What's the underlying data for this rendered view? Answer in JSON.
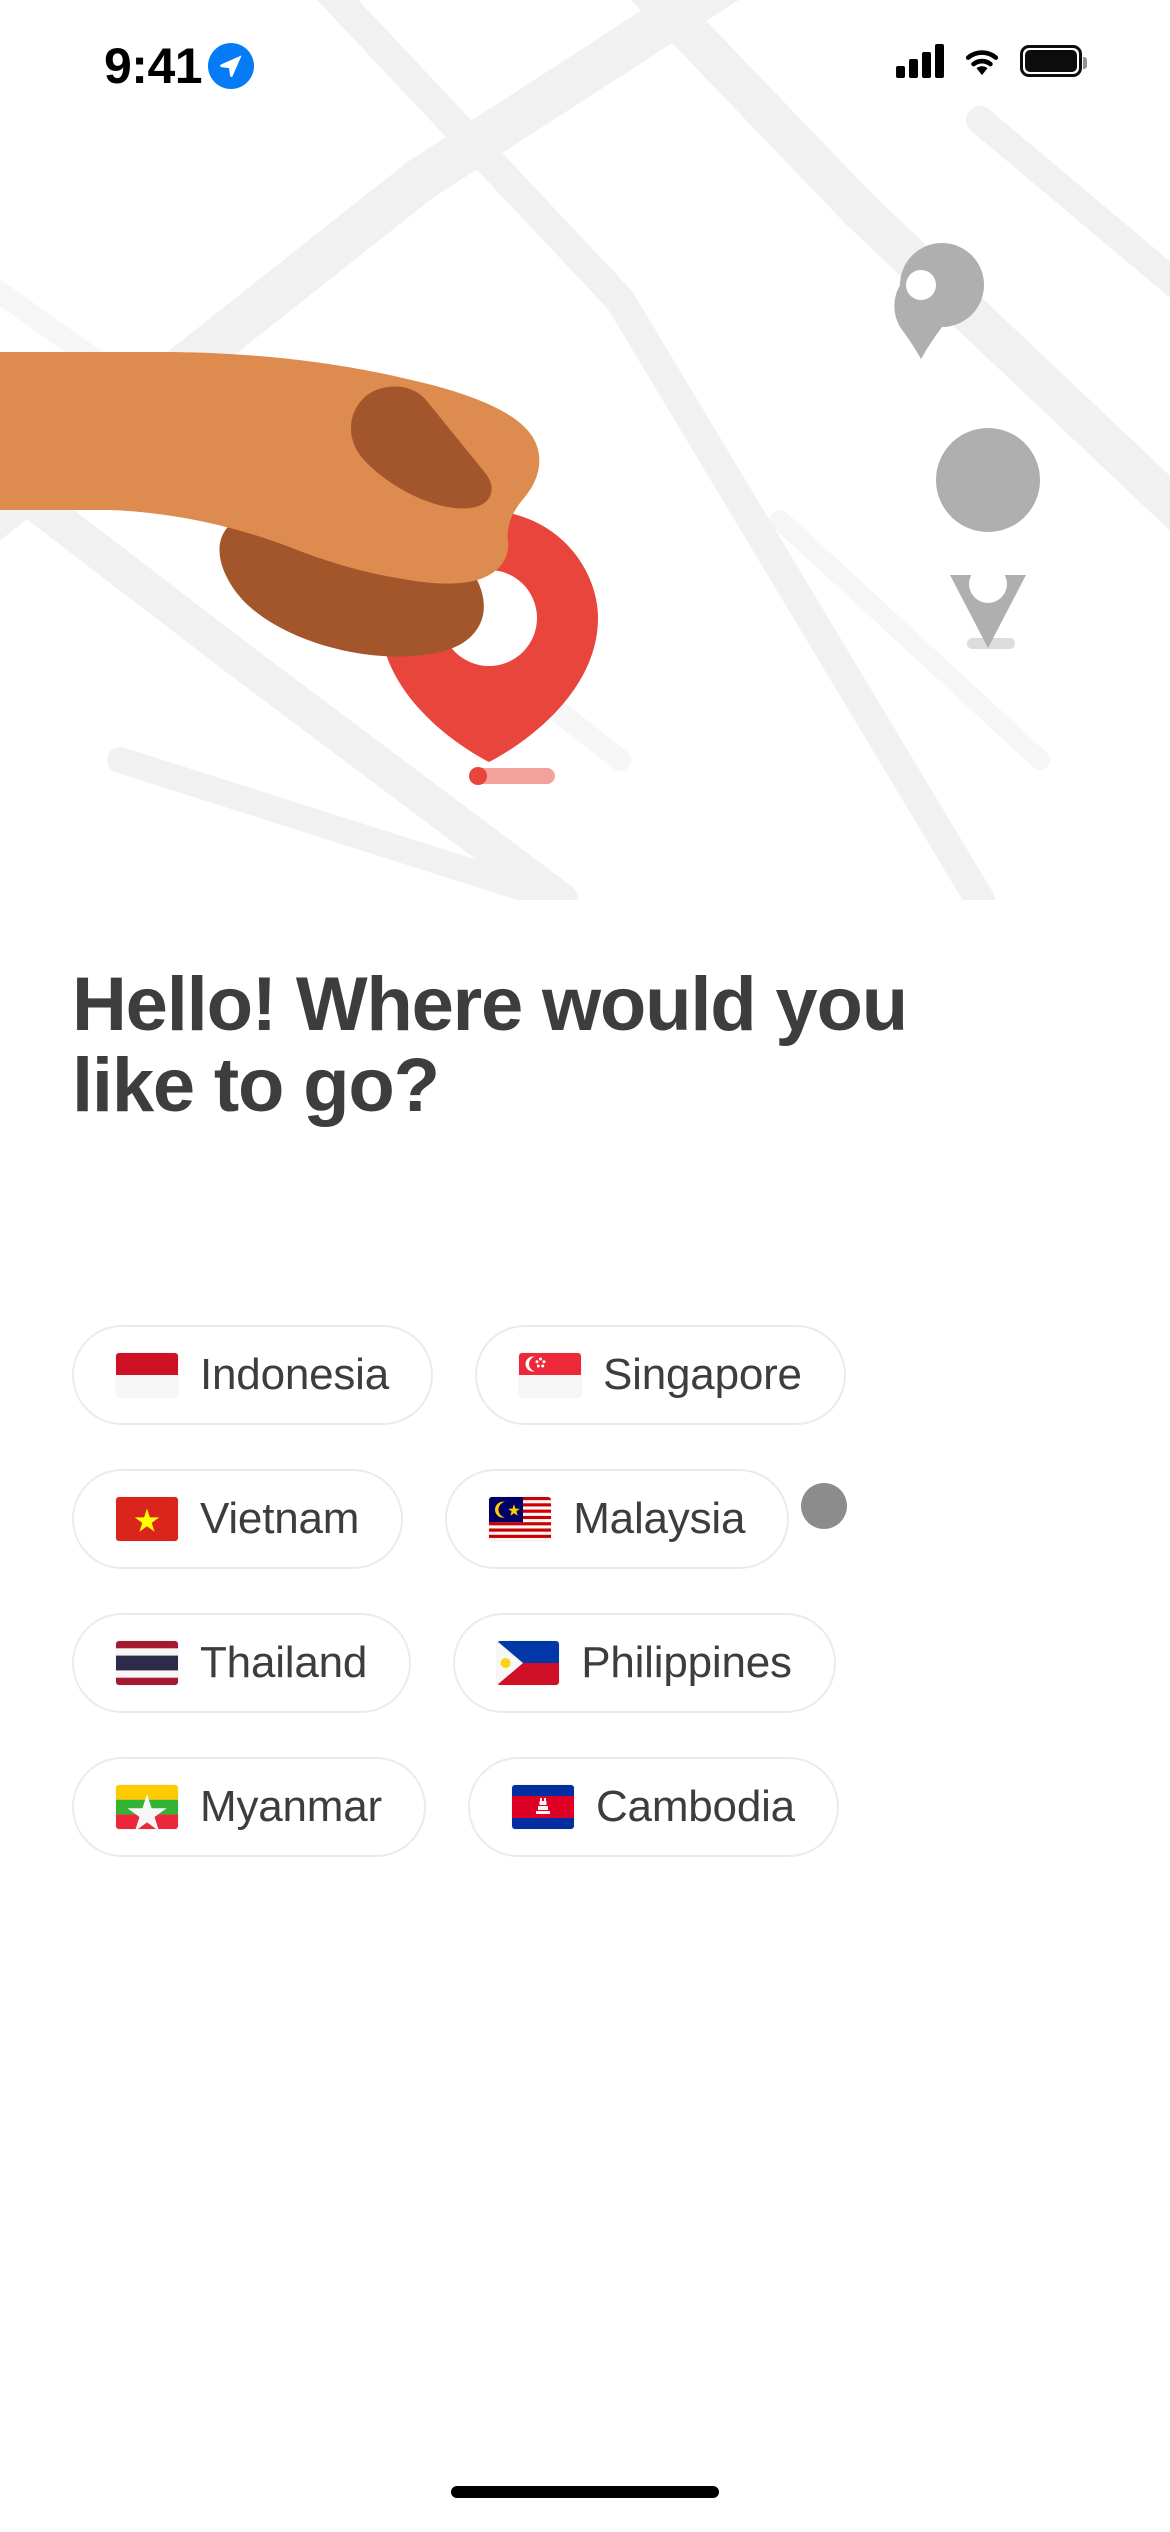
{
  "status_bar": {
    "time": "9:41",
    "location_icon": "location-arrow-icon",
    "signal_icon": "cellular-signal-icon",
    "wifi_icon": "wifi-icon",
    "battery_icon": "battery-full-icon",
    "accent_blue": "#067BF6"
  },
  "hero": {
    "illustration_name": "hand-placing-map-pin-illustration",
    "map_background": "#F2F2F2",
    "pin_color": "#E8453C",
    "pin_shadow_color": "#F29D98",
    "skin_color": "#DD8B4E",
    "skin_shadow_color": "#A3562B",
    "marker_color": "#AFAFAF",
    "markers": [
      {
        "name": "map-marker-top-right"
      },
      {
        "name": "map-marker-right"
      }
    ]
  },
  "headline": {
    "text": "Hello! Where would you like to go?",
    "color": "#3D3D3D"
  },
  "countries": {
    "rows": [
      [
        {
          "name": "Indonesia",
          "flag": "flag-indonesia"
        },
        {
          "name": "Singapore",
          "flag": "flag-singapore"
        }
      ],
      [
        {
          "name": "Vietnam",
          "flag": "flag-vietnam"
        },
        {
          "name": "Malaysia",
          "flag": "flag-malaysia"
        }
      ],
      [
        {
          "name": "Thailand",
          "flag": "flag-thailand"
        },
        {
          "name": "Philippines",
          "flag": "flag-philippines"
        }
      ],
      [
        {
          "name": "Myanmar",
          "flag": "flag-myanmar"
        },
        {
          "name": "Cambodia",
          "flag": "flag-cambodia"
        }
      ]
    ],
    "chip_border_color": "#EBEBEB",
    "chip_text_color": "#3D3D3D"
  },
  "touch_indicator": {
    "name": "touch-cursor-dot",
    "color": "#8C8C8C"
  },
  "home_indicator": {
    "name": "home-indicator",
    "color": "#000000"
  }
}
